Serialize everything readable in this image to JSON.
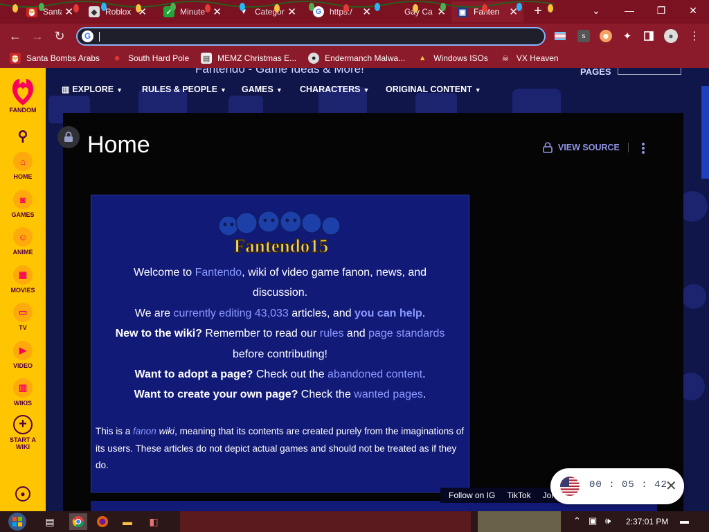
{
  "browser": {
    "tabs": [
      {
        "title": "Santa C",
        "favicon": "tab-favicon-santa",
        "active": false
      },
      {
        "title": "Roblox",
        "favicon": "roblox-icon",
        "active": false
      },
      {
        "title": "Minute",
        "favicon": "check-icon",
        "active": false
      },
      {
        "title": "Categor",
        "favicon": "mask-icon",
        "active": false
      },
      {
        "title": "https:/",
        "favicon": "google-icon",
        "active": false
      },
      {
        "title": "Gay Ca",
        "favicon": "blank-icon",
        "active": false
      },
      {
        "title": "Fanten",
        "favicon": "fandom-favicon",
        "active": true
      }
    ],
    "new_tab_label": "+",
    "address": {
      "value": "",
      "placeholder": ""
    },
    "bookmarks": [
      {
        "label": "Santa Bombs Arabs",
        "icon": "santa-icon"
      },
      {
        "label": "South Hard Pole",
        "icon": "maple-leaf-icon"
      },
      {
        "label": "MEMZ Christmas E...",
        "icon": "video-thumb-icon"
      },
      {
        "label": "Endermanch Malwa...",
        "icon": "github-icon"
      },
      {
        "label": "Windows ISOs",
        "icon": "tux-icon"
      },
      {
        "label": "VX Heaven",
        "icon": "skull-icon"
      }
    ]
  },
  "wiki": {
    "sitename": "Fantendo - Game Ideas & More!",
    "pages_label": "PAGES",
    "nav": [
      {
        "label": "EXPLORE",
        "icon": "book-icon"
      },
      {
        "label": "RULES & PEOPLE"
      },
      {
        "label": "GAMES"
      },
      {
        "label": "CHARACTERS"
      },
      {
        "label": "ORIGINAL CONTENT"
      }
    ],
    "page_title": "Home",
    "view_source": "VIEW SOURCE"
  },
  "fandom_rail": {
    "brand": "FANDOM",
    "items": [
      {
        "label": "HOME",
        "icon": "home-icon"
      },
      {
        "label": "GAMES",
        "icon": "gamepad-icon"
      },
      {
        "label": "ANIME",
        "icon": "anime-face-icon"
      },
      {
        "label": "MOVIES",
        "icon": "clapperboard-icon"
      },
      {
        "label": "TV",
        "icon": "tv-icon"
      },
      {
        "label": "VIDEO",
        "icon": "play-icon"
      },
      {
        "label": "WIKIS",
        "icon": "book-open-icon"
      }
    ],
    "start_wiki_line1": "START A",
    "start_wiki_line2": "WIKI"
  },
  "welcome": {
    "logo_text": "Fantendo15",
    "l1_a": "Welcome to ",
    "l1_link": "Fantendo",
    "l1_b": ", wiki of video game fanon, news, and",
    "l2": "discussion.",
    "l3_a": "We are ",
    "l3_link": "currently editing 43,033",
    "l3_b": " articles, and ",
    "l3_link2": "you can help",
    "l3_c": ".",
    "l4_bold": "New to the wiki?",
    "l4_a": " Remember to read our ",
    "l4_link1": "rules",
    "l4_b": " and ",
    "l4_link2": "page standards",
    "l5": "before contributing!",
    "l6_bold": "Want to adopt a page?",
    "l6_a": " Check out the ",
    "l6_link": "abandoned content",
    "l6_b": ".",
    "l7_bold": "Want to create your own page?",
    "l7_a": " Check the ",
    "l7_link": "wanted pages",
    "l7_b": ".",
    "disc_a": "This is a ",
    "disc_link": "fanon",
    "disc_wiki": " wiki",
    "disc_b": ", meaning that its contents are created purely from the imaginations of its users. These articles do not depict actual games and should not be treated as if they do."
  },
  "follow_bar": {
    "follow_ig": "Follow on IG",
    "tiktok": "TikTok",
    "join": "Joi"
  },
  "timer": {
    "hh": "00",
    "mm": "05",
    "ss": "42",
    "sep": ":"
  },
  "taskbar": {
    "clock": "2:37:01 PM"
  },
  "colors": {
    "tabstrip": "#7a1222",
    "toolbar": "#8b1a2a",
    "fandom_yellow": "#ffc500",
    "fandom_pink": "#fa005a",
    "welcome_bg": "#121a78",
    "link": "#8a9aff",
    "article_bg": "#050505"
  }
}
